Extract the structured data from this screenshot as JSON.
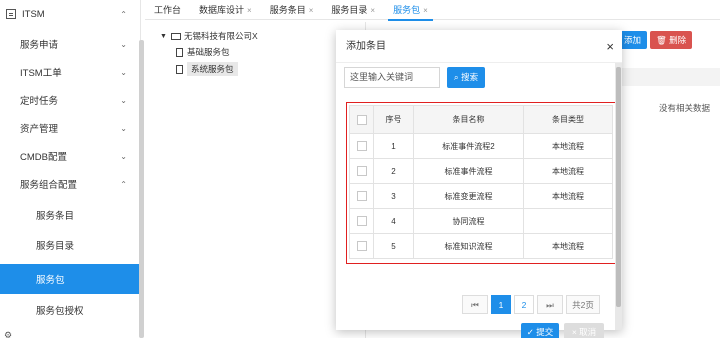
{
  "sidebar": {
    "top_item": "ITSM",
    "items": [
      {
        "label": "服务申请",
        "arrow": "⌄"
      },
      {
        "label": "ITSM工单",
        "arrow": "⌄"
      },
      {
        "label": "定时任务",
        "arrow": "⌄"
      },
      {
        "label": "资产管理",
        "arrow": "⌄"
      },
      {
        "label": "CMDB配置",
        "arrow": "⌄"
      },
      {
        "label": "服务组合配置",
        "arrow": "⌃"
      }
    ],
    "sub_items": [
      "服务条目",
      "服务目录",
      "服务包",
      "服务包授权"
    ],
    "top_arrow": "⌃"
  },
  "tabs": [
    {
      "label": "工作台",
      "closable": false
    },
    {
      "label": "数据库设计",
      "closable": true
    },
    {
      "label": "服务条目",
      "closable": true
    },
    {
      "label": "服务目录",
      "closable": true
    },
    {
      "label": "服务包",
      "closable": true
    }
  ],
  "tab_close": "×",
  "tree": {
    "root": "无锡科技有限公司X",
    "children": [
      "基础服务包",
      "系统服务包"
    ]
  },
  "right_panel": {
    "add_label": "添加",
    "delete_label": "删除",
    "no_data": "没有相关数据"
  },
  "modal": {
    "title": "添加条目",
    "close": "×",
    "search_placeholder": "这里输入关键词",
    "search_button": "搜索",
    "table": {
      "headers": [
        "序号",
        "条目名称",
        "条目类型"
      ],
      "rows": [
        {
          "no": "1",
          "name": "标准事件流程2",
          "type": "本地流程"
        },
        {
          "no": "2",
          "name": "标准事件流程",
          "type": "本地流程"
        },
        {
          "no": "3",
          "name": "标准变更流程",
          "type": "本地流程"
        },
        {
          "no": "4",
          "name": "协同流程",
          "type": ""
        },
        {
          "no": "5",
          "name": "标准知识流程",
          "type": "本地流程"
        }
      ]
    },
    "pager": {
      "first": "⏮",
      "pages": [
        "1",
        "2"
      ],
      "current_page": "1",
      "last": "⏭",
      "total": "共2页"
    },
    "submit_button": "✓ 提交",
    "cancel_button": "× 取消"
  }
}
